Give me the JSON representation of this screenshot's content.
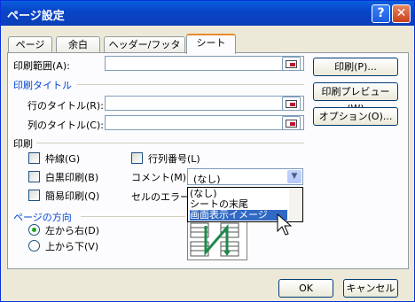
{
  "window": {
    "title": "ページ設定",
    "help_glyph": "?",
    "close_glyph": "✕"
  },
  "tabs": [
    {
      "label": "ページ"
    },
    {
      "label": "余白"
    },
    {
      "label": "ヘッダー/フッター"
    },
    {
      "label": "シート",
      "active": true
    }
  ],
  "sheet": {
    "print_range_label": "印刷範囲(A):",
    "print_titles_section": "印刷タイトル",
    "row_titles_label": "行のタイトル(R):",
    "col_titles_label": "列のタイトル(C):",
    "print_section": "印刷",
    "gridlines_label": "枠線(G)",
    "bw_label": "白黒印刷(B)",
    "draft_label": "簡易印刷(Q)",
    "row_col_headers_label": "行列番号(L)",
    "comments_label": "コメント(M):",
    "cell_errors_label": "セルのエラー(E",
    "comments_value": "(なし)",
    "page_order_section": "ページの方向",
    "down_then_over": "左から右(D)",
    "over_then_down": "上から下(V)",
    "dropdown_items": [
      "(なし)",
      "シートの末尾",
      "画面表示イメージ"
    ],
    "dropdown_selected": 2
  },
  "side_buttons": {
    "print": "印刷(P)...",
    "preview": "印刷プレビュー(W)",
    "options": "オプション(O)..."
  },
  "footer": {
    "ok": "OK",
    "cancel": "キャンセル"
  },
  "colors": {
    "accent": "#316ac5",
    "title_bar": "#0a5fde",
    "tab_highlight": "#e68b2c",
    "preview_arrow": "#1e8a4a"
  }
}
